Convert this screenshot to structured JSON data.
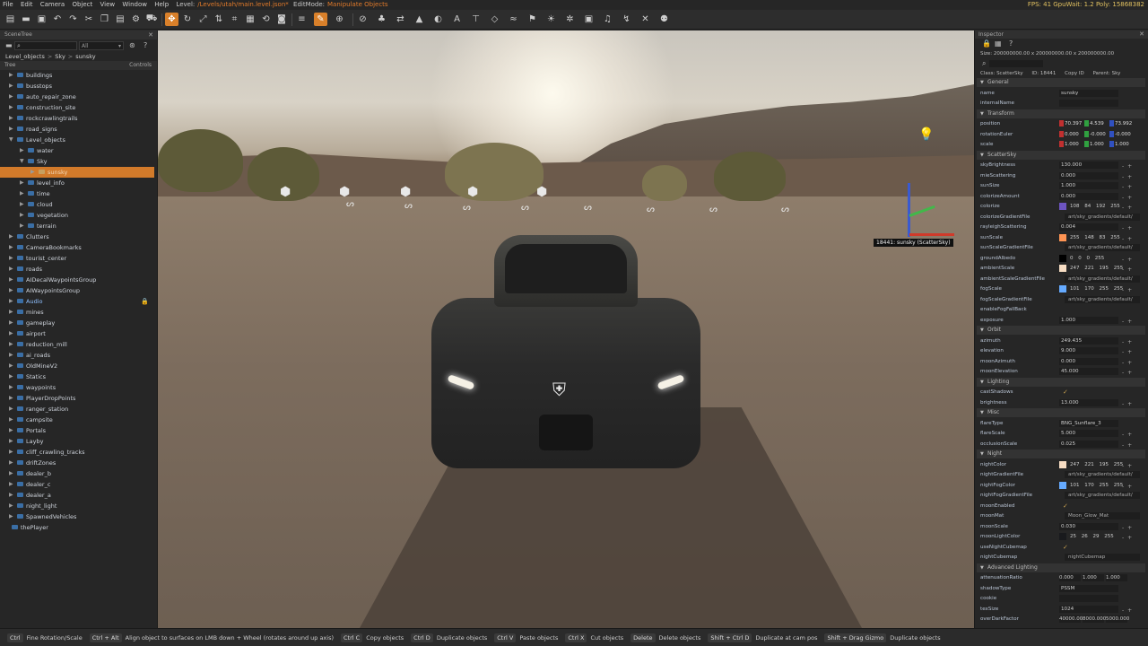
{
  "menubar": {
    "items": [
      "File",
      "Edit",
      "Camera",
      "Object",
      "View",
      "Window",
      "Help"
    ],
    "level_label": "Level:",
    "level_path": "/Levels/utah/main.level.json*",
    "edit_mode_label": "EditMode:",
    "edit_mode": "Manipulate Objects",
    "stats": "FPS: 41  GpuWait: 1.2  Poly: 15868382"
  },
  "toolbar": {
    "icons": [
      "menu-icon",
      "folder-icon",
      "save-icon",
      "undo-icon",
      "redo-icon",
      "cut-icon",
      "copy-icon",
      "paste-icon",
      "settings-icon",
      "car-icon",
      "translate-icon",
      "rotate-icon",
      "scale-icon",
      "align-icon",
      "snap-icon",
      "grid-icon",
      "reset-icon",
      "camera-icon",
      "list-icon",
      "brush-icon",
      "plus-icon",
      "lock-icon",
      "tree-icon",
      "road-icon",
      "terrain-icon",
      "decal-icon",
      "text-icon",
      "sign-icon",
      "mesh-icon",
      "river-icon",
      "flag-icon",
      "light-icon",
      "gear-icon",
      "cube-icon",
      "sound-icon",
      "path-icon",
      "close-icon",
      "spawn-icon"
    ]
  },
  "scenetree": {
    "title": "SceneTree",
    "filter": "All",
    "breadcrumb": [
      "Level_objects",
      "Sky",
      "sunsky"
    ],
    "col_tree": "Tree",
    "col_controls": "Controls",
    "items": [
      {
        "label": "buildings",
        "indent": 0
      },
      {
        "label": "busstops",
        "indent": 0
      },
      {
        "label": "auto_repair_zone",
        "indent": 0
      },
      {
        "label": "construction_site",
        "indent": 0
      },
      {
        "label": "rockcrawlingtrails",
        "indent": 0
      },
      {
        "label": "road_signs",
        "indent": 0
      },
      {
        "label": "Level_objects",
        "indent": 0,
        "open": true
      },
      {
        "label": "water",
        "indent": 1
      },
      {
        "label": "Sky",
        "indent": 1,
        "open": true
      },
      {
        "label": "sunsky",
        "indent": 2,
        "selected": true
      },
      {
        "label": "level_info",
        "indent": 1
      },
      {
        "label": "time",
        "indent": 1
      },
      {
        "label": "cloud",
        "indent": 1
      },
      {
        "label": "vegetation",
        "indent": 1
      },
      {
        "label": "terrain",
        "indent": 1
      },
      {
        "label": "Clutters",
        "indent": 0
      },
      {
        "label": "CameraBookmarks",
        "indent": 0
      },
      {
        "label": "tourist_center",
        "indent": 0
      },
      {
        "label": "roads",
        "indent": 0
      },
      {
        "label": "AIDecalWaypointsGroup",
        "indent": 0
      },
      {
        "label": "AIWaypointsGroup",
        "indent": 0
      },
      {
        "label": "Audio",
        "indent": 0,
        "locked": true
      },
      {
        "label": "mines",
        "indent": 0
      },
      {
        "label": "gameplay",
        "indent": 0
      },
      {
        "label": "airport",
        "indent": 0
      },
      {
        "label": "reduction_mill",
        "indent": 0
      },
      {
        "label": "ai_roads",
        "indent": 0
      },
      {
        "label": "OldMineV2",
        "indent": 0
      },
      {
        "label": "Statics",
        "indent": 0
      },
      {
        "label": "waypoints",
        "indent": 0
      },
      {
        "label": "PlayerDropPoints",
        "indent": 0
      },
      {
        "label": "ranger_station",
        "indent": 0
      },
      {
        "label": "campsite",
        "indent": 0
      },
      {
        "label": "Portals",
        "indent": 0
      },
      {
        "label": "Layby",
        "indent": 0
      },
      {
        "label": "cliff_crawling_tracks",
        "indent": 0
      },
      {
        "label": "driftZones",
        "indent": 0
      },
      {
        "label": "dealer_b",
        "indent": 0
      },
      {
        "label": "dealer_c",
        "indent": 0
      },
      {
        "label": "dealer_a",
        "indent": 0
      },
      {
        "label": "night_light",
        "indent": 0
      },
      {
        "label": "SpawnedVehicles",
        "indent": 0
      },
      {
        "label": "thePlayer",
        "indent": -1
      }
    ]
  },
  "viewport": {
    "selection_label": "18441: sunsky (ScatterSky)"
  },
  "inspector": {
    "title": "Inspector",
    "size_text": "Size: 200000000.00 x 200000000.00 x 200000000.00",
    "class_text": "Class: ScatterSky",
    "id_text": "ID: 18441",
    "copy_id": "Copy ID",
    "parent_text": "Parent: Sky",
    "rows": [
      {
        "t": "sec",
        "label": "General"
      },
      {
        "t": "text",
        "label": "name",
        "value": "sunsky"
      },
      {
        "t": "text",
        "label": "internalName",
        "value": ""
      },
      {
        "t": "sec",
        "label": "Transform"
      },
      {
        "t": "xyz",
        "label": "position",
        "x": "70.397",
        "y": "4.539",
        "z": "73.992"
      },
      {
        "t": "xyz",
        "label": "rotationEuler",
        "x": "0.000",
        "y": "-0.000",
        "z": "-0.000"
      },
      {
        "t": "xyz",
        "label": "scale",
        "x": "1.000",
        "y": "1.000",
        "z": "1.000"
      },
      {
        "t": "sec",
        "label": "ScatterSky"
      },
      {
        "t": "num",
        "label": "skyBrightness",
        "value": "130.000"
      },
      {
        "t": "num",
        "label": "mieScattering",
        "value": "0.000"
      },
      {
        "t": "num",
        "label": "sunSize",
        "value": "1.000"
      },
      {
        "t": "num",
        "label": "colorizeAmount",
        "value": "0.000"
      },
      {
        "t": "color",
        "label": "colorize",
        "color": "#6c54c0",
        "rgba": "108 84 192 255"
      },
      {
        "t": "file",
        "label": "colorizeGradientFile",
        "value": "art/sky_gradients/default/"
      },
      {
        "t": "num",
        "label": "rayleighScattering",
        "value": "0.004"
      },
      {
        "t": "color",
        "label": "sunScale",
        "color": "#ff9453",
        "rgba": "255 148 83 255"
      },
      {
        "t": "file",
        "label": "sunScaleGradientFile",
        "value": "art/sky_gradients/default/"
      },
      {
        "t": "color",
        "label": "groundAlbedo",
        "color": "#000000",
        "rgba": "0 0 0 255"
      },
      {
        "t": "color",
        "label": "ambientScale",
        "color": "#f7ddc3",
        "rgba": "247 221 195 255"
      },
      {
        "t": "file",
        "label": "ambientScaleGradientFile",
        "value": "art/sky_gradients/default/"
      },
      {
        "t": "color",
        "label": "fogScale",
        "color": "#65aaff",
        "rgba": "101 170 255 255"
      },
      {
        "t": "file",
        "label": "fogScaleGradientFile",
        "value": "art/sky_gradients/default/"
      },
      {
        "t": "check",
        "label": "enableFogFallBack",
        "value": ""
      },
      {
        "t": "num",
        "label": "exposure",
        "value": "1.000"
      },
      {
        "t": "sec",
        "label": "Orbit"
      },
      {
        "t": "num",
        "label": "azimuth",
        "value": "249.435"
      },
      {
        "t": "num",
        "label": "elevation",
        "value": "9.000"
      },
      {
        "t": "num",
        "label": "moonAzimuth",
        "value": "0.000"
      },
      {
        "t": "num",
        "label": "moonElevation",
        "value": "45.000"
      },
      {
        "t": "sec",
        "label": "Lighting"
      },
      {
        "t": "check",
        "label": "castShadows",
        "value": "✓"
      },
      {
        "t": "num",
        "label": "brightness",
        "value": "13.000"
      },
      {
        "t": "sec",
        "label": "Misc"
      },
      {
        "t": "text",
        "label": "flareType",
        "value": "BNG_Sunflare_3"
      },
      {
        "t": "num",
        "label": "flareScale",
        "value": "5.000"
      },
      {
        "t": "num",
        "label": "occlusionScale",
        "value": "0.025"
      },
      {
        "t": "sec",
        "label": "Night"
      },
      {
        "t": "color",
        "label": "nightColor",
        "color": "#f7ddc3",
        "rgba": "247 221 195 255"
      },
      {
        "t": "file",
        "label": "nightGradientFile",
        "value": "art/sky_gradients/default/"
      },
      {
        "t": "color",
        "label": "nightFogColor",
        "color": "#65aaff",
        "rgba": "101 170 255 255"
      },
      {
        "t": "file",
        "label": "nightFogGradientFile",
        "value": "art/sky_gradients/default/"
      },
      {
        "t": "check",
        "label": "moonEnabled",
        "value": "✓"
      },
      {
        "t": "file",
        "label": "moonMat",
        "value": "Moon_Glow_Mat"
      },
      {
        "t": "num",
        "label": "moonScale",
        "value": "0.030"
      },
      {
        "t": "color",
        "label": "moonLightColor",
        "color": "#191a1d",
        "rgba": "25 26 29 255"
      },
      {
        "t": "check",
        "label": "useNightCubemap",
        "value": "✓"
      },
      {
        "t": "file",
        "label": "nightCubemap",
        "value": "nightCubemap"
      },
      {
        "t": "sec",
        "label": "Advanced Lighting"
      },
      {
        "t": "trio",
        "label": "attenuationRatio",
        "a": "0.000",
        "b": "1.000",
        "c": "1.000"
      },
      {
        "t": "text",
        "label": "shadowType",
        "value": "PSSM"
      },
      {
        "t": "text",
        "label": "cookie",
        "value": ""
      },
      {
        "t": "num",
        "label": "texSize",
        "value": "1024"
      },
      {
        "t": "trio",
        "label": "overDarkFactor",
        "a": "40000.00",
        "b": "8000.000",
        "c": "5000.000"
      }
    ]
  },
  "statusbar": [
    {
      "key": "Ctrl",
      "desc": "Fine Rotation/Scale"
    },
    {
      "key": "Ctrl + Alt",
      "desc": "Align object to surfaces on LMB down + Wheel (rotates around up axis)"
    },
    {
      "key": "Ctrl C",
      "desc": "Copy objects"
    },
    {
      "key": "Ctrl D",
      "desc": "Duplicate objects"
    },
    {
      "key": "Ctrl V",
      "desc": "Paste objects"
    },
    {
      "key": "Ctrl X",
      "desc": "Cut objects"
    },
    {
      "key": "Delete",
      "desc": "Delete objects"
    },
    {
      "key": "Shift + Ctrl D",
      "desc": "Duplicate at cam pos"
    },
    {
      "key": "Shift + Drag Gizmo",
      "desc": "Duplicate objects"
    }
  ]
}
